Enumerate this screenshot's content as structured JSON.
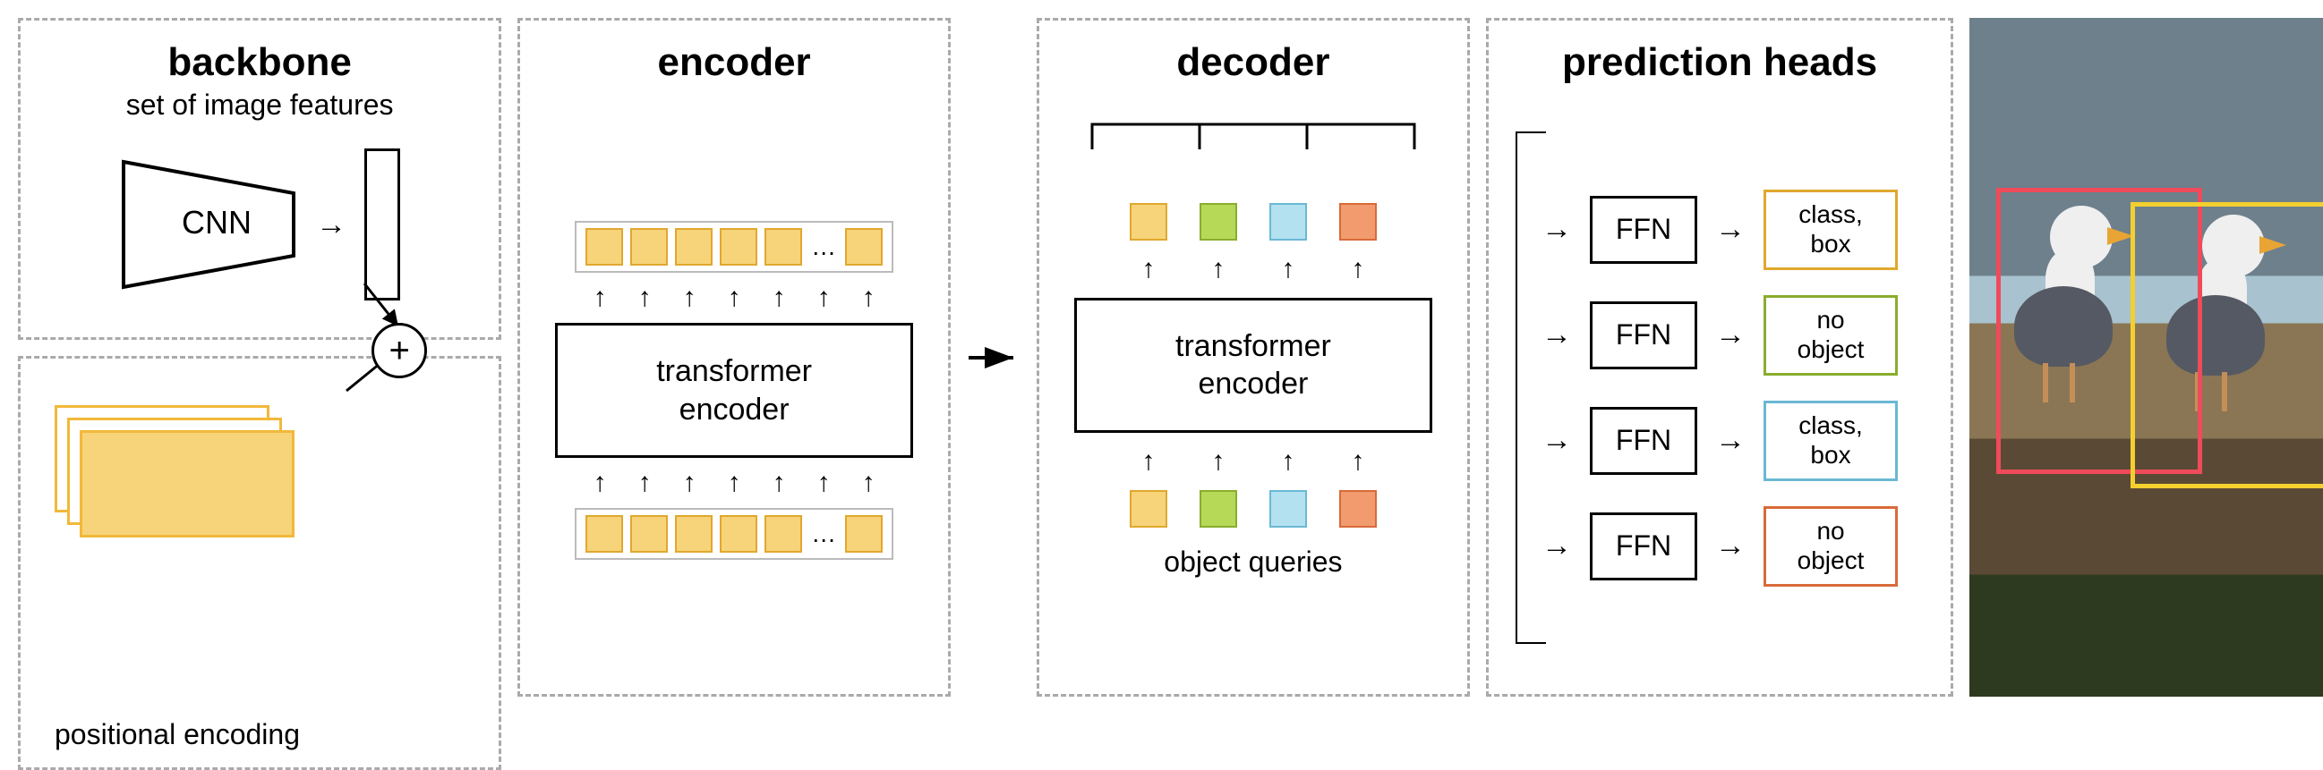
{
  "backbone": {
    "title": "backbone",
    "subtitle": "set of image features",
    "cnn_label": "CNN"
  },
  "positional": {
    "label": "positional encoding"
  },
  "encoder": {
    "title": "encoder",
    "box_label": "transformer\nencoder",
    "top_tokens": [
      "t-yellow",
      "t-yellow",
      "t-yellow",
      "t-yellow",
      "t-yellow",
      "t-yellow"
    ],
    "bottom_tokens": [
      "t-yellow",
      "t-yellow",
      "t-yellow",
      "t-yellow",
      "t-yellow",
      "t-yellow"
    ],
    "ellipsis": "…"
  },
  "decoder": {
    "title": "decoder",
    "box_label": "transformer\nencoder",
    "top_tokens": [
      "t-yellow",
      "t-green",
      "t-blue",
      "t-orange"
    ],
    "bottom_tokens": [
      "t-yellow",
      "t-green",
      "t-blue",
      "t-orange"
    ],
    "bottom_label": "object queries"
  },
  "pred": {
    "title": "prediction heads",
    "ffn_label": "FFN",
    "rows": [
      {
        "class": "ob-yellow",
        "text": "class,\nbox"
      },
      {
        "class": "ob-green",
        "text": "no\nobject"
      },
      {
        "class": "ob-blue",
        "text": "class,\nbox"
      },
      {
        "class": "ob-orange",
        "text": "no\nobject"
      }
    ]
  },
  "plus_sign": "+",
  "arrow_right": "→",
  "arrow_up": "↑",
  "image": {
    "boxes": [
      {
        "color": "red"
      },
      {
        "color": "yellow"
      }
    ]
  }
}
